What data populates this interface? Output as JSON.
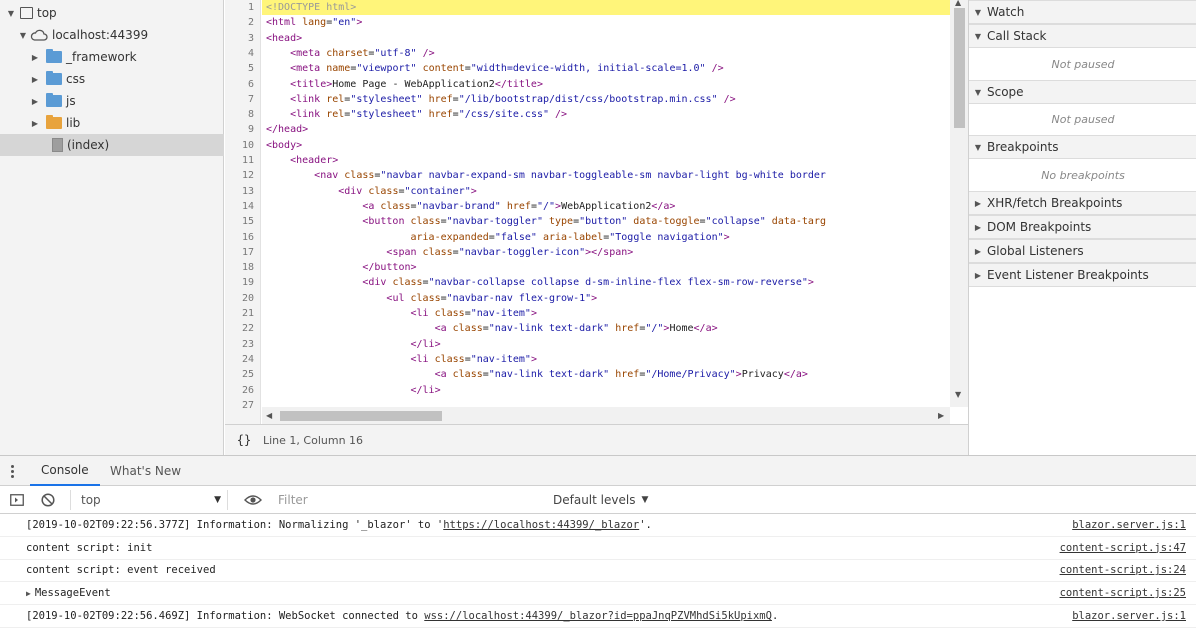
{
  "file_tree": {
    "items": [
      {
        "label": "top",
        "icon": "frame-icon",
        "arrow": "▼"
      },
      {
        "label": "localhost:44399",
        "icon": "cloud-icon",
        "arrow": "▼"
      },
      {
        "label": "_framework",
        "icon": "folder-icon",
        "arrow": "▶",
        "color": "#5b9bd5"
      },
      {
        "label": "css",
        "icon": "folder-icon",
        "arrow": "▶",
        "color": "#5b9bd5"
      },
      {
        "label": "js",
        "icon": "folder-icon",
        "arrow": "▶",
        "color": "#5b9bd5"
      },
      {
        "label": "lib",
        "icon": "folder-icon",
        "arrow": "▶",
        "color": "#e8a33d"
      },
      {
        "label": "(index)",
        "icon": "file-icon",
        "arrow": ""
      }
    ]
  },
  "editor": {
    "line_numbers": [
      "1",
      "2",
      "3",
      "4",
      "5",
      "6",
      "7",
      "8",
      "9",
      "10",
      "11",
      "12",
      "13",
      "14",
      "15",
      "16",
      "17",
      "18",
      "19",
      "20",
      "21",
      "22",
      "23",
      "24",
      "25",
      "26",
      "27"
    ],
    "lines": [
      [
        [
          "doc",
          "<!DOCTYPE html>"
        ]
      ],
      [
        [
          "tag",
          "<html "
        ],
        [
          "attr",
          "lang"
        ],
        [
          "txt",
          "="
        ],
        [
          "val",
          "\"en\""
        ],
        [
          "tag",
          ">"
        ]
      ],
      [
        [
          "tag",
          "<head>"
        ]
      ],
      [
        [
          "txt",
          "    "
        ],
        [
          "tag",
          "<meta "
        ],
        [
          "attr",
          "charset"
        ],
        [
          "txt",
          "="
        ],
        [
          "val",
          "\"utf-8\""
        ],
        [
          "tag",
          " />"
        ]
      ],
      [
        [
          "txt",
          "    "
        ],
        [
          "tag",
          "<meta "
        ],
        [
          "attr",
          "name"
        ],
        [
          "txt",
          "="
        ],
        [
          "val",
          "\"viewport\""
        ],
        [
          "attr",
          " content"
        ],
        [
          "txt",
          "="
        ],
        [
          "val",
          "\"width=device-width, initial-scale=1.0\""
        ],
        [
          "tag",
          " />"
        ]
      ],
      [
        [
          "txt",
          "    "
        ],
        [
          "tag",
          "<title>"
        ],
        [
          "txt",
          "Home Page - WebApplication2"
        ],
        [
          "tag",
          "</title>"
        ]
      ],
      [
        [
          "txt",
          "    "
        ],
        [
          "tag",
          "<link "
        ],
        [
          "attr",
          "rel"
        ],
        [
          "txt",
          "="
        ],
        [
          "val",
          "\"stylesheet\""
        ],
        [
          "attr",
          " href"
        ],
        [
          "txt",
          "="
        ],
        [
          "val",
          "\"/lib/bootstrap/dist/css/bootstrap.min.css\""
        ],
        [
          "tag",
          " />"
        ]
      ],
      [
        [
          "txt",
          "    "
        ],
        [
          "tag",
          "<link "
        ],
        [
          "attr",
          "rel"
        ],
        [
          "txt",
          "="
        ],
        [
          "val",
          "\"stylesheet\""
        ],
        [
          "attr",
          " href"
        ],
        [
          "txt",
          "="
        ],
        [
          "val",
          "\"/css/site.css\""
        ],
        [
          "tag",
          " />"
        ]
      ],
      [
        [
          "tag",
          "</head>"
        ]
      ],
      [
        [
          "tag",
          "<body>"
        ]
      ],
      [
        [
          "txt",
          "    "
        ],
        [
          "tag",
          "<header>"
        ]
      ],
      [
        [
          "txt",
          "        "
        ],
        [
          "tag",
          "<nav "
        ],
        [
          "attr",
          "class"
        ],
        [
          "txt",
          "="
        ],
        [
          "val",
          "\"navbar navbar-expand-sm navbar-toggleable-sm navbar-light bg-white border"
        ]
      ],
      [
        [
          "txt",
          "            "
        ],
        [
          "tag",
          "<div "
        ],
        [
          "attr",
          "class"
        ],
        [
          "txt",
          "="
        ],
        [
          "val",
          "\"container\""
        ],
        [
          "tag",
          ">"
        ]
      ],
      [
        [
          "txt",
          "                "
        ],
        [
          "tag",
          "<a "
        ],
        [
          "attr",
          "class"
        ],
        [
          "txt",
          "="
        ],
        [
          "val",
          "\"navbar-brand\""
        ],
        [
          "attr",
          " href"
        ],
        [
          "txt",
          "="
        ],
        [
          "val",
          "\"/\""
        ],
        [
          "tag",
          ">"
        ],
        [
          "txt",
          "WebApplication2"
        ],
        [
          "tag",
          "</a>"
        ]
      ],
      [
        [
          "txt",
          "                "
        ],
        [
          "tag",
          "<button "
        ],
        [
          "attr",
          "class"
        ],
        [
          "txt",
          "="
        ],
        [
          "val",
          "\"navbar-toggler\""
        ],
        [
          "attr",
          " type"
        ],
        [
          "txt",
          "="
        ],
        [
          "val",
          "\"button\""
        ],
        [
          "attr",
          " data-toggle"
        ],
        [
          "txt",
          "="
        ],
        [
          "val",
          "\"collapse\""
        ],
        [
          "attr",
          " data-targ"
        ]
      ],
      [
        [
          "txt",
          "                        "
        ],
        [
          "attr",
          "aria-expanded"
        ],
        [
          "txt",
          "="
        ],
        [
          "val",
          "\"false\""
        ],
        [
          "attr",
          " aria-label"
        ],
        [
          "txt",
          "="
        ],
        [
          "val",
          "\"Toggle navigation\""
        ],
        [
          "tag",
          ">"
        ]
      ],
      [
        [
          "txt",
          "                    "
        ],
        [
          "tag",
          "<span "
        ],
        [
          "attr",
          "class"
        ],
        [
          "txt",
          "="
        ],
        [
          "val",
          "\"navbar-toggler-icon\""
        ],
        [
          "tag",
          "></span>"
        ]
      ],
      [
        [
          "txt",
          "                "
        ],
        [
          "tag",
          "</button>"
        ]
      ],
      [
        [
          "txt",
          "                "
        ],
        [
          "tag",
          "<div "
        ],
        [
          "attr",
          "class"
        ],
        [
          "txt",
          "="
        ],
        [
          "val",
          "\"navbar-collapse collapse d-sm-inline-flex flex-sm-row-reverse\""
        ],
        [
          "tag",
          ">"
        ]
      ],
      [
        [
          "txt",
          "                    "
        ],
        [
          "tag",
          "<ul "
        ],
        [
          "attr",
          "class"
        ],
        [
          "txt",
          "="
        ],
        [
          "val",
          "\"navbar-nav flex-grow-1\""
        ],
        [
          "tag",
          ">"
        ]
      ],
      [
        [
          "txt",
          "                        "
        ],
        [
          "tag",
          "<li "
        ],
        [
          "attr",
          "class"
        ],
        [
          "txt",
          "="
        ],
        [
          "val",
          "\"nav-item\""
        ],
        [
          "tag",
          ">"
        ]
      ],
      [
        [
          "txt",
          "                            "
        ],
        [
          "tag",
          "<a "
        ],
        [
          "attr",
          "class"
        ],
        [
          "txt",
          "="
        ],
        [
          "val",
          "\"nav-link text-dark\""
        ],
        [
          "attr",
          " href"
        ],
        [
          "txt",
          "="
        ],
        [
          "val",
          "\"/\""
        ],
        [
          "tag",
          ">"
        ],
        [
          "txt",
          "Home"
        ],
        [
          "tag",
          "</a>"
        ]
      ],
      [
        [
          "txt",
          "                        "
        ],
        [
          "tag",
          "</li>"
        ]
      ],
      [
        [
          "txt",
          "                        "
        ],
        [
          "tag",
          "<li "
        ],
        [
          "attr",
          "class"
        ],
        [
          "txt",
          "="
        ],
        [
          "val",
          "\"nav-item\""
        ],
        [
          "tag",
          ">"
        ]
      ],
      [
        [
          "txt",
          "                            "
        ],
        [
          "tag",
          "<a "
        ],
        [
          "attr",
          "class"
        ],
        [
          "txt",
          "="
        ],
        [
          "val",
          "\"nav-link text-dark\""
        ],
        [
          "attr",
          " href"
        ],
        [
          "txt",
          "="
        ],
        [
          "val",
          "\"/Home/Privacy\""
        ],
        [
          "tag",
          ">"
        ],
        [
          "txt",
          "Privacy"
        ],
        [
          "tag",
          "</a>"
        ]
      ],
      [
        [
          "txt",
          "                        "
        ],
        [
          "tag",
          "</li>"
        ]
      ],
      [
        [
          "txt",
          ""
        ]
      ]
    ],
    "status": {
      "format_icon": "{}",
      "cursor_position": "Line 1, Column 16"
    }
  },
  "right_panel": {
    "sections": [
      {
        "title": "Watch",
        "body": ""
      },
      {
        "title": "Call Stack",
        "body": "Not paused"
      },
      {
        "title": "Scope",
        "body": "Not paused"
      },
      {
        "title": "Breakpoints",
        "body": "No breakpoints"
      },
      {
        "title": "XHR/fetch Breakpoints",
        "body": ""
      },
      {
        "title": "DOM Breakpoints",
        "body": ""
      },
      {
        "title": "Global Listeners",
        "body": ""
      },
      {
        "title": "Event Listener Breakpoints",
        "body": ""
      }
    ]
  },
  "drawer": {
    "tabs": {
      "console": "Console",
      "whats_new": "What's New"
    }
  },
  "console_toolbar": {
    "context": "top",
    "filter_placeholder": "Filter",
    "levels": "Default levels"
  },
  "console": {
    "messages": [
      {
        "pre": "[2019-10-02T09:22:56.377Z] Information: Normalizing '_blazor' to '",
        "link": "https://localhost:44399/_blazor",
        "post": "'.",
        "source": "blazor.server.js:1",
        "expandable": false
      },
      {
        "pre": "content script: init",
        "link": "",
        "post": "",
        "source": "content-script.js:47",
        "expandable": false
      },
      {
        "pre": "content script: event received",
        "link": "",
        "post": "",
        "source": "content-script.js:24",
        "expandable": false
      },
      {
        "pre": "MessageEvent",
        "link": "",
        "post": "",
        "source": "content-script.js:25",
        "expandable": true
      },
      {
        "pre": "[2019-10-02T09:22:56.469Z] Information: WebSocket connected to ",
        "link": "wss://localhost:44399/_blazor?id=ppaJnqPZVMhdSi5kUpixmQ",
        "post": ".",
        "source": "blazor.server.js:1",
        "expandable": false
      }
    ]
  }
}
